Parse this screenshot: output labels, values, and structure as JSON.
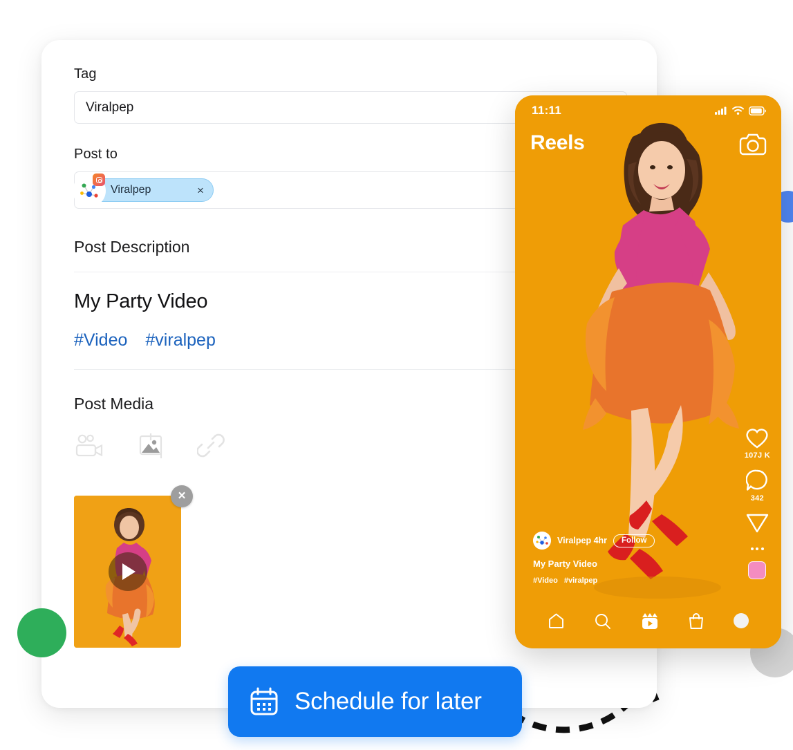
{
  "composer": {
    "tag": {
      "label": "Tag",
      "value": "Viralpep"
    },
    "post_to": {
      "label": "Post to",
      "chip": {
        "name": "Viralpep",
        "remove": "×",
        "platform_icon": "instagram-icon"
      }
    },
    "description": {
      "section_label": "Post Description",
      "title": "My Party Video",
      "hashtags": [
        "#Video",
        "#viralpep"
      ]
    },
    "media": {
      "section_label": "Post Media",
      "tools": [
        {
          "icon": "video-camera-icon",
          "name": "add-video"
        },
        {
          "icon": "image-icon",
          "name": "add-image"
        },
        {
          "icon": "link-icon",
          "name": "add-link"
        }
      ],
      "attachment": {
        "remove": "×",
        "play": "play-icon"
      }
    }
  },
  "schedule_button": {
    "label": "Schedule for later",
    "icon": "calendar-icon"
  },
  "phone": {
    "status_bar": {
      "time": "11:11",
      "signal": "cellular-icon",
      "wifi": "wifi-icon",
      "battery": "battery-icon"
    },
    "header": {
      "title": "Reels",
      "camera": "camera-icon"
    },
    "actions": {
      "like": {
        "icon": "heart-icon",
        "count": "107J K"
      },
      "comment": {
        "icon": "comment-icon",
        "count": "342"
      },
      "share": {
        "icon": "send-icon"
      },
      "more": {
        "icon": "more-dots-icon"
      },
      "audio": {
        "icon": "audio-thumbnail"
      }
    },
    "post": {
      "username": "Viralpep 4hr",
      "follow_label": "Follow",
      "title": "My Party Video",
      "hashtags": [
        "#Video",
        "#viralpep"
      ]
    },
    "nav": [
      {
        "name": "home",
        "icon": "home-icon"
      },
      {
        "name": "search",
        "icon": "search-icon"
      },
      {
        "name": "reels",
        "icon": "reels-icon"
      },
      {
        "name": "shop",
        "icon": "shopping-bag-icon"
      },
      {
        "name": "profile",
        "icon": "profile-avatar"
      }
    ]
  },
  "colors": {
    "accent_blue": "#1179f0",
    "orange": "#ef9d06",
    "green_dot": "#2eae5a",
    "blue_dot": "#5086f2",
    "gray_dot": "#d4d4d4",
    "hashtag_blue": "#1b62bd"
  }
}
